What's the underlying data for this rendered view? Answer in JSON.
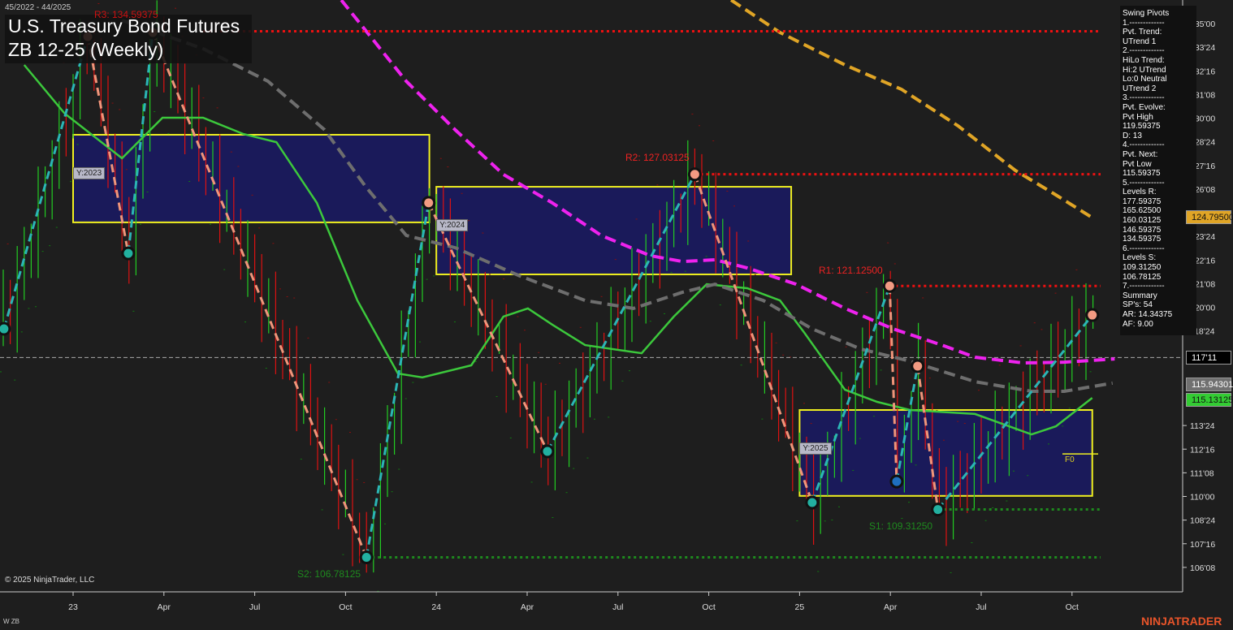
{
  "header": {
    "date_range": "45/2022 - 44/2025",
    "title_line1": "U.S. Treasury Bond Futures",
    "title_line2": "ZB 12-25 (Weekly)"
  },
  "footer": {
    "copyright": "© 2025 NinjaTrader, LLC",
    "instrument_code": "W ZB",
    "brand": "NINJATRADER"
  },
  "info_panel": {
    "lines": [
      "Swing Pivots",
      "1.-------------",
      "Pvt. Trend:",
      "UTrend 1",
      "2.-------------",
      "HiLo Trend:",
      "Hi:2 UTrend",
      "Lo:0 Neutral",
      "UTrend 2",
      "3.-------------",
      "Pvt. Evolve:",
      "Pvt High",
      "119.59375",
      "D: 13",
      "4.-------------",
      "Pvt. Next:",
      "Pvt Low",
      "115.59375",
      "5.-------------",
      "Levels R:",
      "177.59375",
      "165.62500",
      "160.03125",
      "146.59375",
      "134.59375",
      "6.-------------",
      "Levels S:",
      "109.31250",
      "106.78125",
      "7.-------------",
      "Summary",
      "SP's: 54",
      "AR: 14.34375",
      "AF: 9.00"
    ]
  },
  "price_tags": [
    {
      "label": "124.79500",
      "value": 124.795,
      "bg": "#e0a526",
      "fg": "#111"
    },
    {
      "label": "117'11",
      "value": 117.34375,
      "bg": "#000000",
      "fg": "#fff"
    },
    {
      "label": "115.94301",
      "value": 115.94301,
      "bg": "#707070",
      "fg": "#fff"
    },
    {
      "label": "115.13125",
      "value": 115.13125,
      "bg": "#33cc33",
      "fg": "#111"
    }
  ],
  "year_boxes": [
    {
      "label": "Y:2023",
      "start_week": 0,
      "end_week": 51,
      "high": 129.12,
      "low": 124.49
    },
    {
      "label": "Y:2024",
      "start_week": 52,
      "end_week": 102.8,
      "high": 126.37,
      "low": 121.74
    },
    {
      "label": "Y:2025",
      "start_week": 104,
      "end_week": 145.9,
      "high": 114.57,
      "low": 110.03
    }
  ],
  "levels": [
    {
      "label": "R3: 134.59375",
      "value": 134.59375,
      "from_week": 18.6,
      "color": "#ee1111",
      "label_color": "#cc1111"
    },
    {
      "label": "R2: 127.03125",
      "value": 127.03125,
      "from_week": 89,
      "color": "#ee1111",
      "label_color": "#ee2222"
    },
    {
      "label": "R1: 121.12500",
      "value": 121.125,
      "from_week": 116.9,
      "color": "#ee1111",
      "label_color": "#ee2222"
    },
    {
      "label": "S1: 109.31250",
      "value": 109.3125,
      "from_week": 123.8,
      "color": "#1e8a1e",
      "label_color": "#1e8a1e"
    },
    {
      "label": "S2: 106.78125",
      "value": 106.78125,
      "from_week": 42,
      "color": "#1e8a1e",
      "label_color": "#1e8a1e"
    }
  ],
  "fib": {
    "label": "F0",
    "value": 112.25
  },
  "chart_data": {
    "type": "line",
    "title": "U.S. Treasury Bond Futures ZB 12-25 (Weekly)",
    "x_unit": "weeks since Jan 2023",
    "x_ticks": [
      {
        "label": "23",
        "week": 0
      },
      {
        "label": "Apr",
        "week": 13
      },
      {
        "label": "Jul",
        "week": 26
      },
      {
        "label": "Oct",
        "week": 39
      },
      {
        "label": "24",
        "week": 52
      },
      {
        "label": "Apr",
        "week": 65
      },
      {
        "label": "Jul",
        "week": 78
      },
      {
        "label": "Oct",
        "week": 91
      },
      {
        "label": "25",
        "week": 104
      },
      {
        "label": "Apr",
        "week": 117
      },
      {
        "label": "Jul",
        "week": 130
      },
      {
        "label": "Oct",
        "week": 143
      }
    ],
    "y_ticks": [
      {
        "label": "135'00",
        "v": 135
      },
      {
        "label": "133'24",
        "v": 133.75
      },
      {
        "label": "132'16",
        "v": 132.5
      },
      {
        "label": "131'08",
        "v": 131.25
      },
      {
        "label": "130'00",
        "v": 130
      },
      {
        "label": "128'24",
        "v": 128.75
      },
      {
        "label": "127'16",
        "v": 127.5
      },
      {
        "label": "126'08",
        "v": 126.25
      },
      {
        "label": "123'24",
        "v": 123.75
      },
      {
        "label": "122'16",
        "v": 122.5
      },
      {
        "label": "121'08",
        "v": 121.25
      },
      {
        "label": "120'00",
        "v": 120
      },
      {
        "label": "118'24",
        "v": 118.75
      },
      {
        "label": "113'24",
        "v": 113.75
      },
      {
        "label": "112'16",
        "v": 112.5
      },
      {
        "label": "111'08",
        "v": 111.25
      },
      {
        "label": "110'00",
        "v": 110
      },
      {
        "label": "108'24",
        "v": 108.75
      },
      {
        "label": "107'16",
        "v": 107.5
      },
      {
        "label": "106'08",
        "v": 106.25
      }
    ],
    "ylim": [
      105.3,
      136.2
    ],
    "xlim": [
      -10.5,
      159.3
    ],
    "last_price": 117.34375,
    "swing_pivots": [
      [
        -9.9,
        118.86,
        "L"
      ],
      [
        2.1,
        134.31,
        "H"
      ],
      [
        7.9,
        122.85,
        "L"
      ],
      [
        11.4,
        134.53,
        "H"
      ],
      [
        42.0,
        106.78,
        "L"
      ],
      [
        50.9,
        125.52,
        "H"
      ],
      [
        67.9,
        112.38,
        "L"
      ],
      [
        89.0,
        127.03,
        "H"
      ],
      [
        105.8,
        109.68,
        "L"
      ],
      [
        116.9,
        121.125,
        "H"
      ],
      [
        117.9,
        110.79,
        "L"
      ],
      [
        120.9,
        116.89,
        "H"
      ],
      [
        123.8,
        109.31,
        "L"
      ],
      [
        145.9,
        119.59,
        "H"
      ]
    ],
    "series": [
      {
        "name": "fast-ma",
        "color": "#3cc83c",
        "dashed": false,
        "points": [
          [
            -7.0,
            132.81
          ],
          [
            -1.2,
            130.24
          ],
          [
            7.0,
            127.88
          ],
          [
            12.8,
            130.02
          ],
          [
            18.6,
            130.02
          ],
          [
            24.4,
            129.16
          ],
          [
            29.1,
            128.73
          ],
          [
            34.9,
            125.52
          ],
          [
            40.7,
            120.36
          ],
          [
            46.5,
            116.5
          ],
          [
            50.0,
            116.29
          ],
          [
            57.0,
            116.93
          ],
          [
            61.6,
            119.51
          ],
          [
            65.1,
            119.94
          ],
          [
            68.6,
            119.08
          ],
          [
            73.3,
            118.0
          ],
          [
            81.4,
            117.57
          ],
          [
            86.0,
            119.51
          ],
          [
            90.7,
            121.22
          ],
          [
            96.5,
            121.01
          ],
          [
            101.2,
            120.36
          ],
          [
            104.7,
            118.65
          ],
          [
            110.5,
            115.64
          ],
          [
            115.1,
            115.0
          ],
          [
            119.8,
            114.57
          ],
          [
            129.1,
            114.36
          ],
          [
            137.2,
            113.28
          ],
          [
            140.7,
            113.71
          ],
          [
            145.9,
            115.21
          ]
        ]
      },
      {
        "name": "mid-ma",
        "color": "#6e6e6e",
        "dashed": true,
        "points": [
          [
            7.0,
            135.17
          ],
          [
            18.6,
            133.67
          ],
          [
            27.9,
            131.95
          ],
          [
            36.0,
            129.38
          ],
          [
            41.9,
            126.37
          ],
          [
            47.7,
            123.8
          ],
          [
            54.7,
            123.15
          ],
          [
            64.0,
            121.65
          ],
          [
            73.3,
            120.36
          ],
          [
            80.2,
            119.94
          ],
          [
            87.2,
            120.79
          ],
          [
            91.9,
            121.22
          ],
          [
            98.8,
            120.36
          ],
          [
            105.8,
            118.86
          ],
          [
            112.8,
            117.79
          ],
          [
            119.8,
            117.15
          ],
          [
            129.1,
            116.07
          ],
          [
            137.2,
            115.56
          ],
          [
            141.9,
            115.56
          ],
          [
            148.8,
            115.99
          ]
        ]
      },
      {
        "name": "slow-ma",
        "color": "#ee22ee",
        "dashed": true,
        "points": [
          [
            38.4,
            136.24
          ],
          [
            47.7,
            131.95
          ],
          [
            54.7,
            129.38
          ],
          [
            61.6,
            127.02
          ],
          [
            68.6,
            125.52
          ],
          [
            75.6,
            123.8
          ],
          [
            82.6,
            122.73
          ],
          [
            87.2,
            122.42
          ],
          [
            91.9,
            122.51
          ],
          [
            96.5,
            122.08
          ],
          [
            103.5,
            121.22
          ],
          [
            110.5,
            119.94
          ],
          [
            117.4,
            118.86
          ],
          [
            124.4,
            118.0
          ],
          [
            129.1,
            117.36
          ],
          [
            136.0,
            117.06
          ],
          [
            141.9,
            117.1
          ],
          [
            149.1,
            117.27
          ]
        ]
      },
      {
        "name": "long-ma",
        "color": "#e0a526",
        "dashed": true,
        "points": [
          [
            94.2,
            136.24
          ],
          [
            101.2,
            134.53
          ],
          [
            110.5,
            132.81
          ],
          [
            118.6,
            131.52
          ],
          [
            126.7,
            129.59
          ],
          [
            134.9,
            127.23
          ],
          [
            140.7,
            125.94
          ],
          [
            145.9,
            124.74
          ]
        ]
      }
    ]
  }
}
